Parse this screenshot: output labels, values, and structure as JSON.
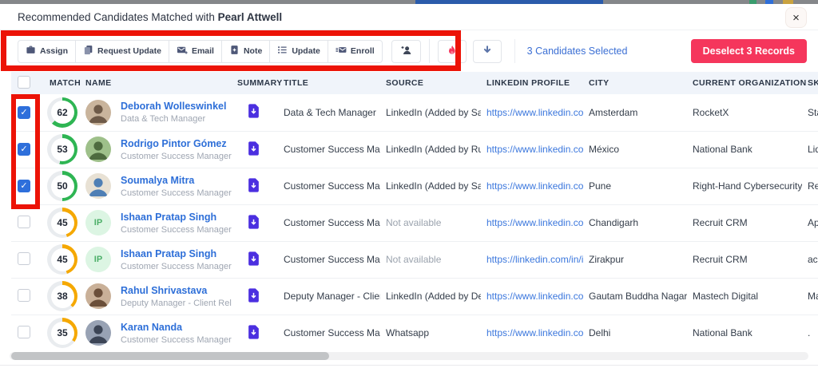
{
  "colors": {
    "accent_blue": "#2e6fdb",
    "link_blue": "#3b77dd",
    "match_green": "#2eb553",
    "match_orange": "#f5a800",
    "summary_purple": "#4b2fe0",
    "pink_button": "#f5365c",
    "annotation_red": "#ec1307"
  },
  "modal": {
    "title_prefix": "Recommended Candidates Matched with",
    "title_name": "Pearl Attwell",
    "close_label": "×"
  },
  "toolbar": {
    "buttons": [
      {
        "label": "Assign",
        "icon": "briefcase-icon"
      },
      {
        "label": "Request Update",
        "icon": "copy-icon"
      },
      {
        "label": "Email",
        "icon": "email-plus-icon"
      },
      {
        "label": "Note",
        "icon": "note-plus-icon"
      },
      {
        "label": "Update",
        "icon": "list-icon"
      },
      {
        "label": "Enroll",
        "icon": "enroll-mail-icon"
      }
    ],
    "icon_buttons": [
      {
        "icon": "person-add-icon"
      },
      {
        "icon": "flame-icon",
        "color": "#f5365c"
      },
      {
        "icon": "download-icon",
        "color": "#5b74a8"
      }
    ],
    "selected_text": "3 Candidates Selected",
    "deselect_button": "Deselect 3 Records"
  },
  "table": {
    "headers": [
      "MATCH",
      "NAME",
      "SUMMARY",
      "TITLE",
      "SOURCE",
      "LINKEDIN PROFILE",
      "CITY",
      "CURRENT ORGANIZATION",
      "SKILLS"
    ],
    "rows": [
      {
        "checked": true,
        "match": 62,
        "ring_color": "#2eb553",
        "avatar": {
          "type": "photo",
          "bg": "#c9b49c",
          "fg": "#6e5a48"
        },
        "name": "Deborah Wolleswinkel",
        "subtitle": "Data & Tech Manager",
        "title": "Data & Tech Manager",
        "source": "LinkedIn (Added by Saur...",
        "linkedin": "https://www.linkedin.co...",
        "city": "Amsterdam",
        "organization": "RocketX",
        "skills": "Sta"
      },
      {
        "checked": true,
        "match": 53,
        "ring_color": "#2eb553",
        "avatar": {
          "type": "photo",
          "bg": "#9ec08a",
          "fg": "#4e6b3f"
        },
        "name": "Rodrigo Pintor Gómez",
        "subtitle": "Customer Success Manager",
        "title": "Customer Success Man...",
        "source": "LinkedIn (Added by Rutv...",
        "linkedin": "https://www.linkedin.co...",
        "city": "México",
        "organization": "National Bank",
        "skills": "Lide"
      },
      {
        "checked": true,
        "match": 50,
        "ring_color": "#2eb553",
        "avatar": {
          "type": "photo",
          "bg": "#e8e1d4",
          "fg": "#4f7fb5"
        },
        "name": "Soumalya Mitra",
        "subtitle": "Customer Success Manager",
        "title": "Customer Success Man...",
        "source": "LinkedIn (Added by Sanj...",
        "linkedin": "https://www.linkedin.co...",
        "city": "Pune",
        "organization": "Right-Hand Cybersecurity",
        "skills": "Rec"
      },
      {
        "checked": false,
        "match": 45,
        "ring_color": "#f5a800",
        "avatar": {
          "type": "initials",
          "text": "IP",
          "bg": "#dcf5e3",
          "fg": "#4caf68"
        },
        "name": "Ishaan Pratap Singh",
        "subtitle": "Customer Success Manager",
        "title": "Customer Success Man...",
        "source": "Not available",
        "linkedin": "https://www.linkedin.co...",
        "city": "Chandigarh",
        "organization": "Recruit CRM",
        "skills": "App"
      },
      {
        "checked": false,
        "match": 45,
        "ring_color": "#f5a800",
        "avatar": {
          "type": "initials",
          "text": "IP",
          "bg": "#dcf5e3",
          "fg": "#4caf68"
        },
        "name": "Ishaan Pratap Singh",
        "subtitle": "Customer Success Manager",
        "title": "Customer Success Man...",
        "source": "Not available",
        "linkedin": "https://linkedin.com/in/i...",
        "city": "Zirakpur",
        "organization": "Recruit CRM",
        "skills": "acc"
      },
      {
        "checked": false,
        "match": 38,
        "ring_color": "#f5a800",
        "avatar": {
          "type": "photo",
          "bg": "#c9b098",
          "fg": "#6b4f3a"
        },
        "name": "Rahul Shrivastava",
        "subtitle": "Deputy Manager - Client Rel...",
        "title": "Deputy Manager - Client ...",
        "source": "LinkedIn (Added by Dee...",
        "linkedin": "https://www.linkedin.co...",
        "city": "Gautam Buddha Nagar",
        "organization": "Mastech Digital",
        "skills": "Mar"
      },
      {
        "checked": false,
        "match": 35,
        "ring_color": "#f5a800",
        "avatar": {
          "type": "photo",
          "bg": "#98a2b4",
          "fg": "#3c4556"
        },
        "name": "Karan Nanda",
        "subtitle": "Customer Success Manager",
        "title": "Customer Success Man...",
        "source": "Whatsapp",
        "linkedin": "https://www.linkedin.co...",
        "city": "Delhi",
        "organization": "National Bank",
        "skills": "."
      }
    ]
  }
}
